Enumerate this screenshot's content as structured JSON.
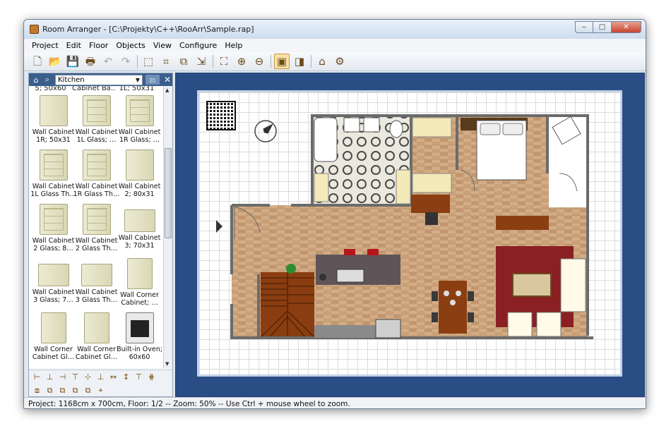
{
  "window": {
    "title": "Room Arranger - [C:\\Projekty\\C++\\RooArr\\Sample.rap]",
    "buttons": {
      "minimize": "‒",
      "maximize": "□",
      "close": "✕"
    }
  },
  "menu": [
    {
      "label": "Project"
    },
    {
      "label": "Edit"
    },
    {
      "label": "Floor"
    },
    {
      "label": "Objects"
    },
    {
      "label": "View"
    },
    {
      "label": "Configure"
    },
    {
      "label": "Help"
    }
  ],
  "toolbar": {
    "new": "🗋",
    "open": "📂",
    "save": "💾",
    "print": "🖶",
    "undo": "↶",
    "redo": "↷",
    "tool_a": "⬚",
    "tool_b": "⌗",
    "tool_c": "⧉",
    "tool_d": "⇲",
    "zoom_fit": "⛶",
    "zoom_in": "⊕",
    "zoom_out": "⊖",
    "view_2d": "▣",
    "view_3d": "◨",
    "objects_3d": "⌂",
    "settings": "⚙"
  },
  "library": {
    "home_icon": "⌂",
    "search_icon": "⌕",
    "category": "Kitchen",
    "pin": "▯▯",
    "close": "✕",
    "top_labels": [
      "5; 50x60",
      "Cabinet Ba…",
      "1L; 50x31"
    ],
    "items": [
      {
        "line1": "Wall Cabinet",
        "line2": "1R; 50x31",
        "thumb": "plain"
      },
      {
        "line1": "Wall Cabinet",
        "line2": "1L Glass; …",
        "thumb": "glass"
      },
      {
        "line1": "Wall Cabinet",
        "line2": "1R Glass; …",
        "thumb": "glass"
      },
      {
        "line1": "Wall Cabinet",
        "line2": "1L Glass Th…",
        "thumb": "glass"
      },
      {
        "line1": "Wall Cabinet",
        "line2": "1R Glass Th…",
        "thumb": "glass"
      },
      {
        "line1": "Wall Cabinet",
        "line2": "2; 80x31",
        "thumb": "plain"
      },
      {
        "line1": "Wall Cabinet",
        "line2": "2 Glass; 8…",
        "thumb": "glass"
      },
      {
        "line1": "Wall Cabinet",
        "line2": "2 Glass Th…",
        "thumb": "glass"
      },
      {
        "line1": "Wall Cabinet",
        "line2": "3; 70x31",
        "thumb": "wide"
      },
      {
        "line1": "Wall Cabinet",
        "line2": "3 Glass; 7…",
        "thumb": "wide"
      },
      {
        "line1": "Wall Cabinet",
        "line2": "3 Glass Th…",
        "thumb": "wide"
      },
      {
        "line1": "Wall Corner",
        "line2": "Cabinet; …",
        "thumb": "corner"
      },
      {
        "line1": "Wall Corner",
        "line2": "Cabinet Gl…",
        "thumb": "corner"
      },
      {
        "line1": "Wall Corner",
        "line2": "Cabinet Gl…",
        "thumb": "corner"
      },
      {
        "line1": "Built-in Oven;",
        "line2": "60x60",
        "thumb": "oven"
      }
    ]
  },
  "align_tools": {
    "row1": [
      "⊢",
      "⊥",
      "⊣",
      "⊤",
      "⊹",
      "⊥",
      "↔",
      "↕",
      "⊤",
      "⋕"
    ],
    "row2": [
      "⧈",
      "⧉",
      "⧉",
      "⧉",
      "⧉",
      "⌖"
    ]
  },
  "status": "Project: 1168cm x 700cm, Floor: 1/2 -- Zoom: 50% -- Use Ctrl + mouse wheel to zoom.",
  "colors": {
    "canvas_bg": "#2b4d86",
    "wall": "#6b6b6b",
    "wood_floor": "#cfa77f",
    "tile_floor": "#e8e6dc",
    "rug": "#8a2023",
    "table": "#8b3e12",
    "stairs": "#8a3d10"
  }
}
